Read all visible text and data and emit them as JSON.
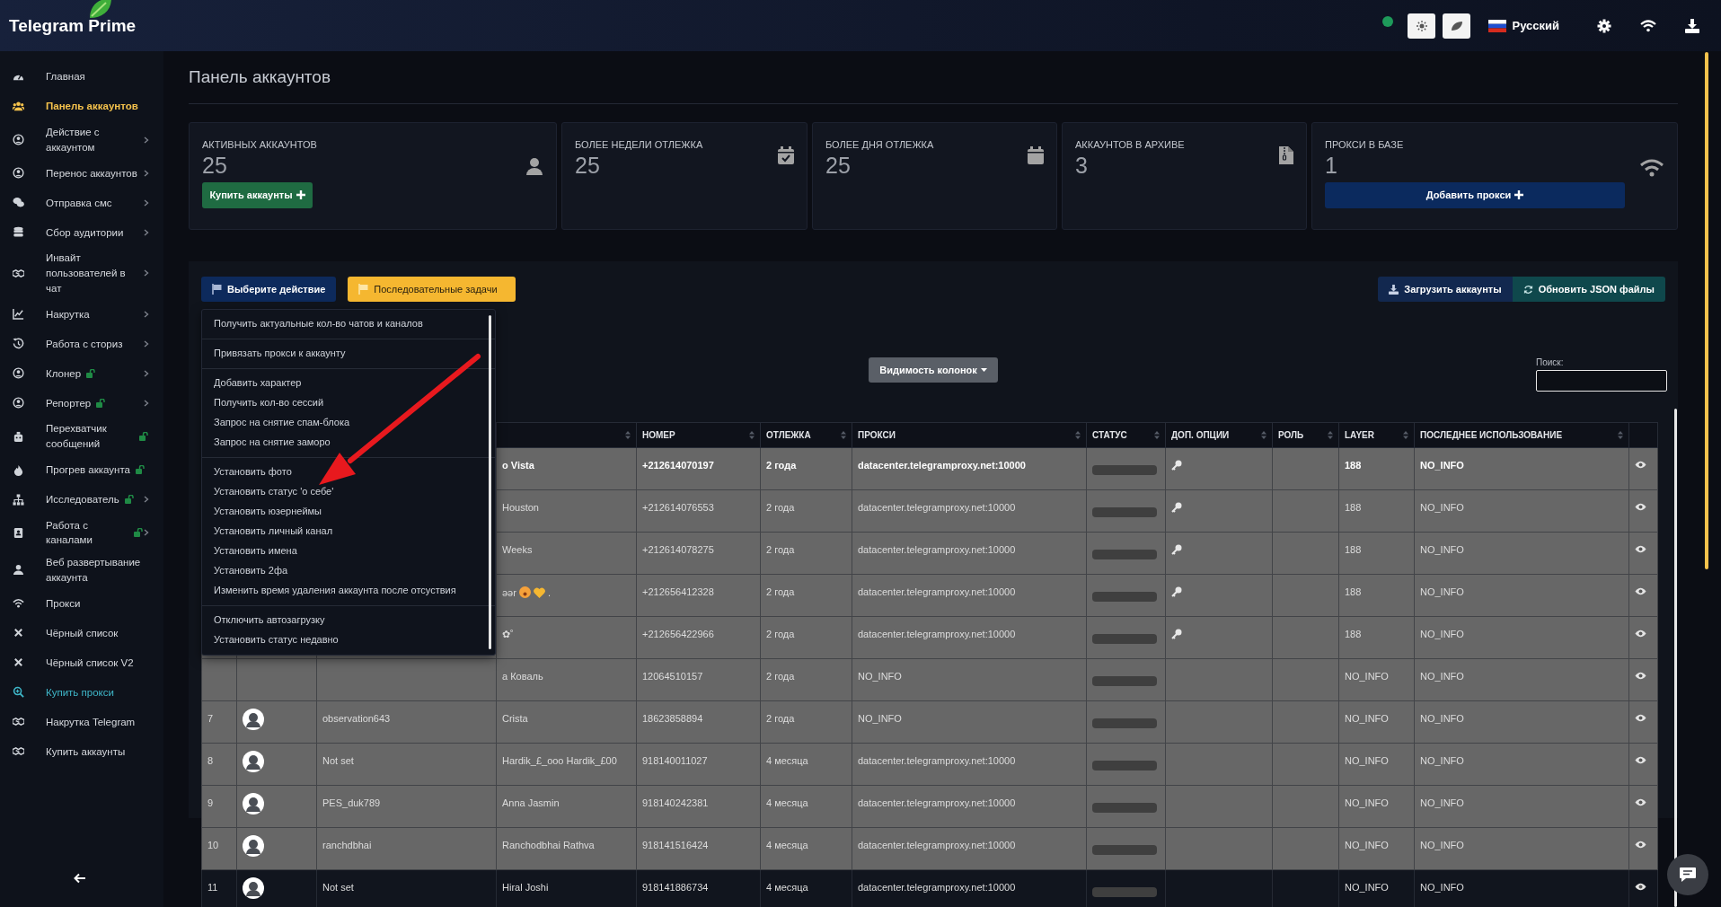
{
  "header": {
    "logo": "Telegram Prime",
    "online": true,
    "language": "Русский"
  },
  "sidebar": {
    "items": [
      {
        "label": "Главная",
        "selected": false,
        "accent": false,
        "lock": false,
        "expandable": false
      },
      {
        "label": "Панель аккаунтов",
        "selected": true,
        "accent": false,
        "lock": false,
        "expandable": false
      },
      {
        "label": "Действие с аккаунтом",
        "selected": false,
        "accent": false,
        "lock": false,
        "expandable": true
      },
      {
        "label": "Перенос аккаунтов",
        "selected": false,
        "accent": false,
        "lock": false,
        "expandable": true
      },
      {
        "label": "Отправка смс",
        "selected": false,
        "accent": false,
        "lock": false,
        "expandable": true
      },
      {
        "label": "Сбор аудитории",
        "selected": false,
        "accent": false,
        "lock": false,
        "expandable": true
      },
      {
        "label": "Инвайт пользователей в чат",
        "selected": false,
        "accent": false,
        "lock": false,
        "expandable": true
      },
      {
        "label": "Накрутка",
        "selected": false,
        "accent": false,
        "lock": false,
        "expandable": true
      },
      {
        "label": "Работа с сториз",
        "selected": false,
        "accent": false,
        "lock": false,
        "expandable": true
      },
      {
        "label": "Клонер",
        "selected": false,
        "accent": false,
        "lock": true,
        "expandable": true
      },
      {
        "label": "Репортер",
        "selected": false,
        "accent": false,
        "lock": true,
        "expandable": true
      },
      {
        "label": "Перехватчик сообщений",
        "selected": false,
        "accent": false,
        "lock": true,
        "expandable": false
      },
      {
        "label": "Прогрев аккаунта",
        "selected": false,
        "accent": false,
        "lock": true,
        "expandable": false
      },
      {
        "label": "Исследователь",
        "selected": false,
        "accent": false,
        "lock": true,
        "expandable": true
      },
      {
        "label": "Работа с каналами",
        "selected": false,
        "accent": false,
        "lock": true,
        "expandable": true
      },
      {
        "label": "Веб развертывание аккаунта",
        "selected": false,
        "accent": false,
        "lock": false,
        "expandable": false
      },
      {
        "label": "Прокси",
        "selected": false,
        "accent": false,
        "lock": false,
        "expandable": false
      },
      {
        "label": "Чёрный список",
        "selected": false,
        "accent": false,
        "lock": false,
        "expandable": false
      },
      {
        "label": "Чёрный список V2",
        "selected": false,
        "accent": false,
        "lock": false,
        "expandable": false
      },
      {
        "label": "Купить прокси",
        "selected": false,
        "accent": true,
        "lock": false,
        "expandable": false
      },
      {
        "label": "Накрутка Telegram",
        "selected": false,
        "accent": false,
        "lock": false,
        "expandable": false
      },
      {
        "label": "Купить аккаунты",
        "selected": false,
        "accent": false,
        "lock": false,
        "expandable": false
      }
    ]
  },
  "page_title": "Панель аккаунтов",
  "stats": [
    {
      "label": "АКТИВНЫХ АККАУНТОВ",
      "value": "25",
      "button": "Купить аккаунты",
      "kind": "user"
    },
    {
      "label": "БОЛЕЕ НЕДЕЛИ ОТЛЕЖКА",
      "value": "25",
      "kind": "calendar-check"
    },
    {
      "label": "БОЛЕЕ ДНЯ ОТЛЕЖКА",
      "value": "25",
      "kind": "calendar"
    },
    {
      "label": "АККАУНТОВ В АРХИВЕ",
      "value": "3",
      "kind": "archive"
    },
    {
      "label": "ПРОКСИ В БАЗЕ",
      "value": "1",
      "button": "Добавить прокси",
      "kind": "wifi"
    }
  ],
  "toolbar": {
    "action_button": "Выберите действие",
    "tasks_button": "Последовательные задачи",
    "upload_button": "Загрузить аккаунты",
    "refresh_button": "Обновить JSON файлы",
    "columns_button": "Видимость колонок",
    "search_label": "Поиск:"
  },
  "action_menu": [
    [
      "Получить актуальные кол-во чатов и каналов"
    ],
    [
      "Привязать прокси к аккаунту"
    ],
    [
      "Добавить характер",
      "Получить кол-во сессий",
      "Запрос на снятие спам-блока",
      "Запрос на снятие заморо"
    ],
    [
      "Установить фото",
      "Установить статус 'о себе'",
      "Установить юзернеймы",
      "Установить личный канал",
      "Установить имена",
      "Установить 2фа",
      "Изменить время удаления аккаунта после отсуствия"
    ],
    [
      "Отключить автозагрузку",
      "Установить статус недавно"
    ]
  ],
  "table": {
    "columns": [
      "НОМЕР",
      "ОТЛЕЖКА",
      "ПРОКСИ",
      "СТАТУС",
      "ДОП. ОПЦИИ",
      "РОЛЬ",
      "LAYER",
      "ПОСЛЕДНЕЕ ИСПОЛЬЗОВАНИЕ"
    ],
    "rows": [
      {
        "selected": true,
        "active": true,
        "name": "o Vista",
        "phone": "+212614070197",
        "age": "2 года",
        "proxy": "datacenter.telegramproxy.net:10000",
        "key": true,
        "layer": "188",
        "last_used": "NO_INFO"
      },
      {
        "selected": true,
        "active": false,
        "name": "Houston",
        "phone": "+212614076553",
        "age": "2 года",
        "proxy": "datacenter.telegramproxy.net:10000",
        "key": true,
        "layer": "188",
        "last_used": "NO_INFO"
      },
      {
        "selected": true,
        "active": false,
        "name": "Weeks",
        "phone": "+212614078275",
        "age": "2 года",
        "proxy": "datacenter.telegramproxy.net:10000",
        "key": true,
        "layer": "188",
        "last_used": "NO_INFO"
      },
      {
        "selected": true,
        "active": false,
        "name": "əər",
        "emoji": true,
        "heart": true,
        "name_suffix": ".",
        "phone": "+212656412328",
        "age": "2 года",
        "proxy": "datacenter.telegramproxy.net:10000",
        "key": true,
        "layer": "188",
        "last_used": "NO_INFO"
      },
      {
        "selected": true,
        "active": false,
        "name": "✿˚",
        "phone": "+212656422966",
        "age": "2 года",
        "proxy": "datacenter.telegramproxy.net:10000",
        "key": true,
        "layer": "188",
        "last_used": "NO_INFO"
      },
      {
        "selected": true,
        "active": false,
        "name": "a Коваль",
        "phone": "12064510157",
        "age": "2 года",
        "proxy": "NO_INFO",
        "key": false,
        "layer": "NO_INFO",
        "last_used": "NO_INFO"
      },
      {
        "selected": true,
        "active": false,
        "index": "7",
        "username": "observation643",
        "name": "Crista",
        "phone": "18623858894",
        "age": "2 года",
        "proxy": "NO_INFO",
        "key": false,
        "layer": "NO_INFO",
        "last_used": "NO_INFO"
      },
      {
        "selected": true,
        "active": false,
        "index": "8",
        "username": "Not set",
        "name": "Hardik_£_ooo Hardik_£00",
        "phone": "918140011027",
        "age": "4 месяца",
        "proxy": "datacenter.telegramproxy.net:10000",
        "key": false,
        "layer": "NO_INFO",
        "last_used": "NO_INFO"
      },
      {
        "selected": true,
        "active": false,
        "index": "9",
        "username": "PES_duk789",
        "name": "Anna Jasmin",
        "phone": "918140242381",
        "age": "4 месяца",
        "proxy": "datacenter.telegramproxy.net:10000",
        "key": false,
        "layer": "NO_INFO",
        "last_used": "NO_INFO"
      },
      {
        "selected": true,
        "active": false,
        "index": "10",
        "username": "ranchdbhai",
        "name": "Ranchodbhai Rathva",
        "phone": "918141516424",
        "age": "4 месяца",
        "proxy": "datacenter.telegramproxy.net:10000",
        "key": false,
        "layer": "NO_INFO",
        "last_used": "NO_INFO"
      },
      {
        "selected": false,
        "active": false,
        "index": "11",
        "username": "Not set",
        "name": "Hiral Joshi",
        "phone": "918141886734",
        "age": "4 месяца",
        "proxy": "datacenter.telegramproxy.net:10000",
        "key": false,
        "layer": "NO_INFO",
        "last_used": "NO_INFO"
      }
    ]
  }
}
